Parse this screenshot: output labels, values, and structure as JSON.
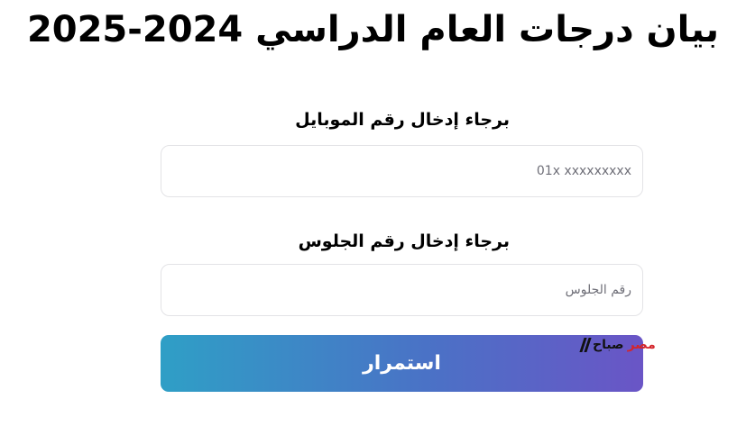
{
  "header": {
    "title": "بيان درجات العام الدراسي 2024-2025"
  },
  "form": {
    "mobile": {
      "label": "برجاء إدخال رقم الموبايل",
      "placeholder": "01x xxxxxxxxx",
      "value": ""
    },
    "seat": {
      "label": "برجاء إدخال رقم الجلوس",
      "placeholder": "رقم الجلوس",
      "value": ""
    },
    "submit_label": "استمرار"
  },
  "watermark": {
    "text_primary": "صباح",
    "text_secondary": "مصر"
  },
  "colors": {
    "button_gradient_start": "#2f9fc6",
    "button_gradient_end": "#6a55c6",
    "watermark_red": "#d4252b"
  }
}
